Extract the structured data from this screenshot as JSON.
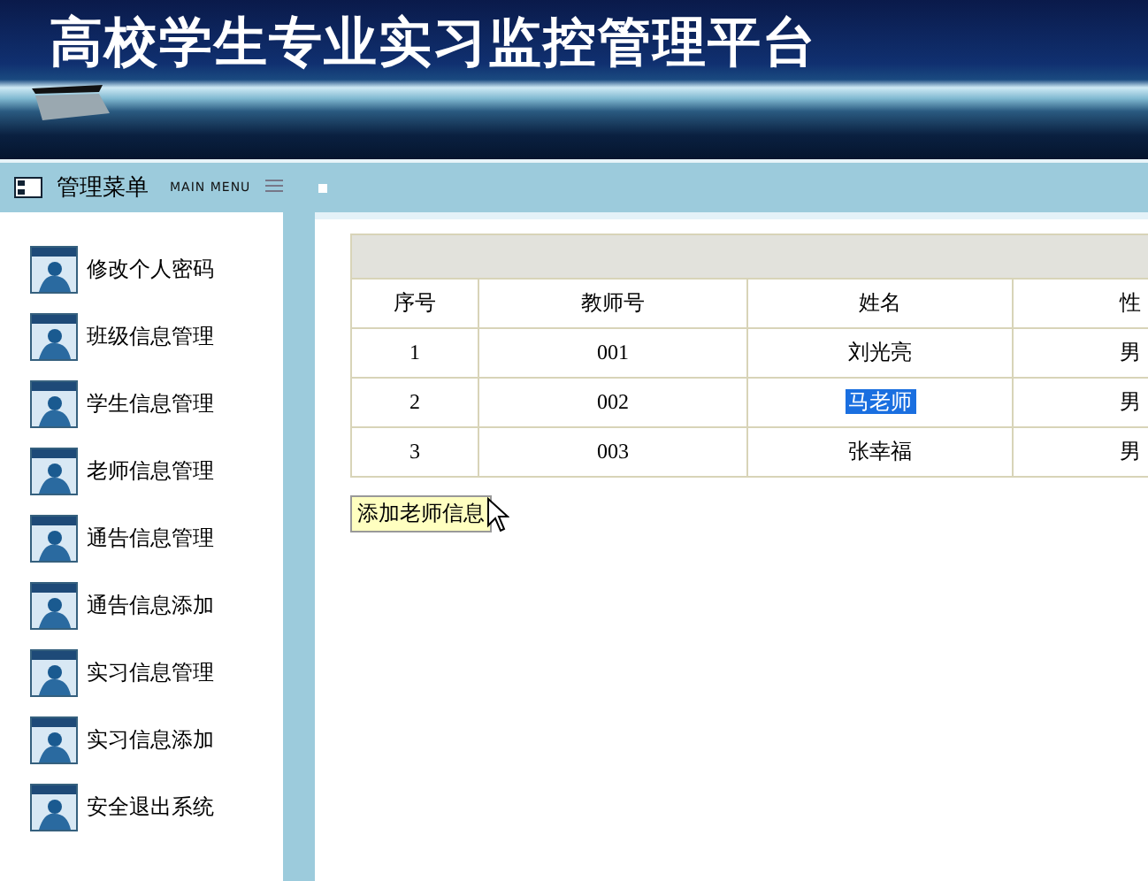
{
  "header": {
    "title": "高校学生专业实习监控管理平台"
  },
  "menu_bar": {
    "title": "管理菜单",
    "subtitle": "MAIN MENU"
  },
  "sidebar": {
    "items": [
      {
        "label": "修改个人密码"
      },
      {
        "label": "班级信息管理"
      },
      {
        "label": "学生信息管理"
      },
      {
        "label": "老师信息管理"
      },
      {
        "label": "通告信息管理"
      },
      {
        "label": "通告信息添加"
      },
      {
        "label": "实习信息管理"
      },
      {
        "label": "实习信息添加"
      },
      {
        "label": "安全退出系统"
      }
    ]
  },
  "table": {
    "columns": [
      "序号",
      "教师号",
      "姓名",
      "性"
    ],
    "rows": [
      {
        "cells": [
          "1",
          "001",
          "刘光亮",
          "男"
        ],
        "selected": false
      },
      {
        "cells": [
          "2",
          "002",
          "马老师",
          "男"
        ],
        "selected": true
      },
      {
        "cells": [
          "3",
          "003",
          "张幸福",
          "男"
        ],
        "selected": false
      }
    ]
  },
  "add_button": {
    "label": "添加老师信息"
  }
}
